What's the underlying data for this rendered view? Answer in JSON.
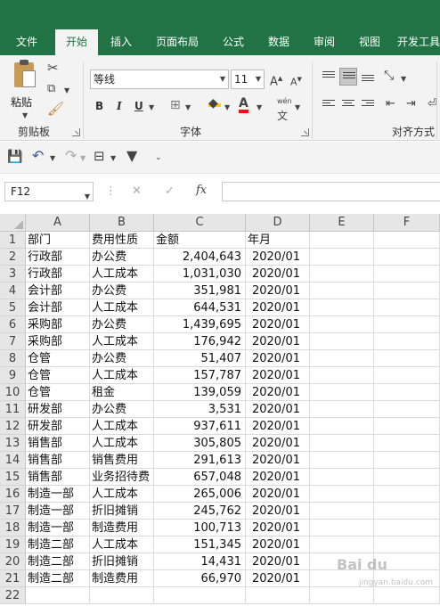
{
  "ribbon": {
    "tabs": [
      {
        "label": "文件"
      },
      {
        "label": "开始"
      },
      {
        "label": "插入"
      },
      {
        "label": "页面布局"
      },
      {
        "label": "公式"
      },
      {
        "label": "数据"
      },
      {
        "label": "审阅"
      },
      {
        "label": "视图"
      },
      {
        "label": "开发工具"
      }
    ],
    "clipboard": {
      "paste_label": "粘贴",
      "group_label": "剪贴板"
    },
    "font": {
      "font_name": "等线",
      "font_size": "11",
      "group_label": "字体",
      "bold": "B",
      "italic": "I",
      "underline": "U",
      "grow": "A",
      "shrink": "A",
      "font_color": "A",
      "phonetic": "wén"
    },
    "alignment": {
      "group_label": "对齐方式"
    }
  },
  "formula_bar": {
    "name_box": "F12",
    "fx_label": "fx",
    "content": ""
  },
  "sheet": {
    "columns": [
      "A",
      "B",
      "C",
      "D",
      "E",
      "F"
    ],
    "rows": [
      [
        "部门",
        "费用性质",
        "金额",
        "年月"
      ],
      [
        "行政部",
        "办公费",
        "2,404,643",
        "2020/01"
      ],
      [
        "行政部",
        "人工成本",
        "1,031,030",
        "2020/01"
      ],
      [
        "会计部",
        "办公费",
        "351,981",
        "2020/01"
      ],
      [
        "会计部",
        "人工成本",
        "644,531",
        "2020/01"
      ],
      [
        "采购部",
        "办公费",
        "1,439,695",
        "2020/01"
      ],
      [
        "采购部",
        "人工成本",
        "176,942",
        "2020/01"
      ],
      [
        "仓管",
        "办公费",
        "51,407",
        "2020/01"
      ],
      [
        "仓管",
        "人工成本",
        "157,787",
        "2020/01"
      ],
      [
        "仓管",
        "租金",
        "139,059",
        "2020/01"
      ],
      [
        "研发部",
        "办公费",
        "3,531",
        "2020/01"
      ],
      [
        "研发部",
        "人工成本",
        "937,611",
        "2020/01"
      ],
      [
        "销售部",
        "人工成本",
        "305,805",
        "2020/01"
      ],
      [
        "销售部",
        "销售费用",
        "291,613",
        "2020/01"
      ],
      [
        "销售部",
        "业务招待费",
        "657,048",
        "2020/01"
      ],
      [
        "制造一部",
        "人工成本",
        "265,006",
        "2020/01"
      ],
      [
        "制造一部",
        "折旧摊销",
        "245,762",
        "2020/01"
      ],
      [
        "制造一部",
        "制造费用",
        "100,713",
        "2020/01"
      ],
      [
        "制造二部",
        "人工成本",
        "151,345",
        "2020/01"
      ],
      [
        "制造二部",
        "折旧摊销",
        "14,431",
        "2020/01"
      ],
      [
        "制造二部",
        "制造费用",
        "66,970",
        "2020/01"
      ],
      [
        "",
        "",
        "",
        ""
      ]
    ]
  },
  "watermark": {
    "text": "Bai du",
    "sub": "jingyan.baidu.com"
  },
  "colors": {
    "ribbon_green": "#217346",
    "ribbon_bg": "#f3f3f3",
    "header_bg": "#e6e6e6"
  }
}
